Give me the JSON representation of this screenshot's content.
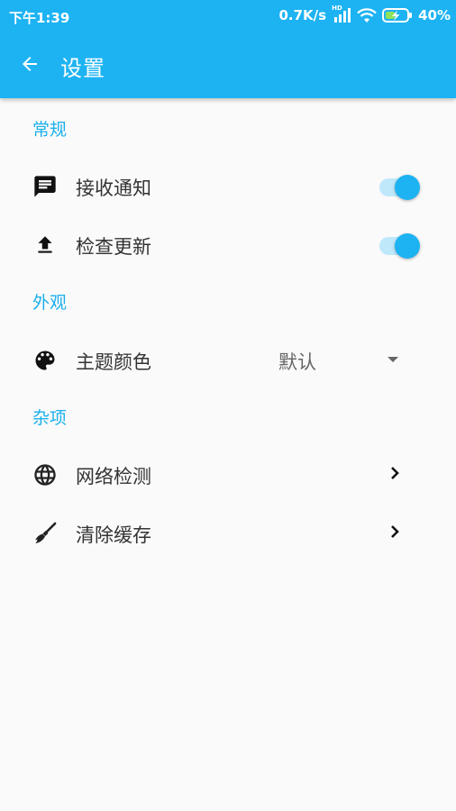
{
  "status_bar": {
    "time": "下午1:39",
    "network_speed": "0.7K/s",
    "network_badge": "HD",
    "battery_percent": "40%",
    "icons": [
      "signal-icon",
      "wifi-icon",
      "battery-charging-icon"
    ]
  },
  "toolbar": {
    "title": "设置",
    "back_icon": "arrow-back-icon"
  },
  "sections": [
    {
      "header": "常规",
      "items": [
        {
          "label": "接收通知",
          "icon": "message-icon",
          "control": "switch",
          "checked": true
        },
        {
          "label": "检查更新",
          "icon": "upload-icon",
          "control": "switch",
          "checked": true
        }
      ]
    },
    {
      "header": "外观",
      "items": [
        {
          "label": "主题颜色",
          "icon": "palette-icon",
          "control": "dropdown",
          "value": "默认"
        }
      ]
    },
    {
      "header": "杂项",
      "items": [
        {
          "label": "网络检测",
          "icon": "globe-icon",
          "control": "chevron"
        },
        {
          "label": "清除缓存",
          "icon": "broom-icon",
          "control": "chevron"
        }
      ]
    }
  ],
  "colors": {
    "primary": "#1db3f3",
    "section_header": "#1ab0ec",
    "switch_track": "#bfe8fb",
    "background": "#fafafa"
  }
}
